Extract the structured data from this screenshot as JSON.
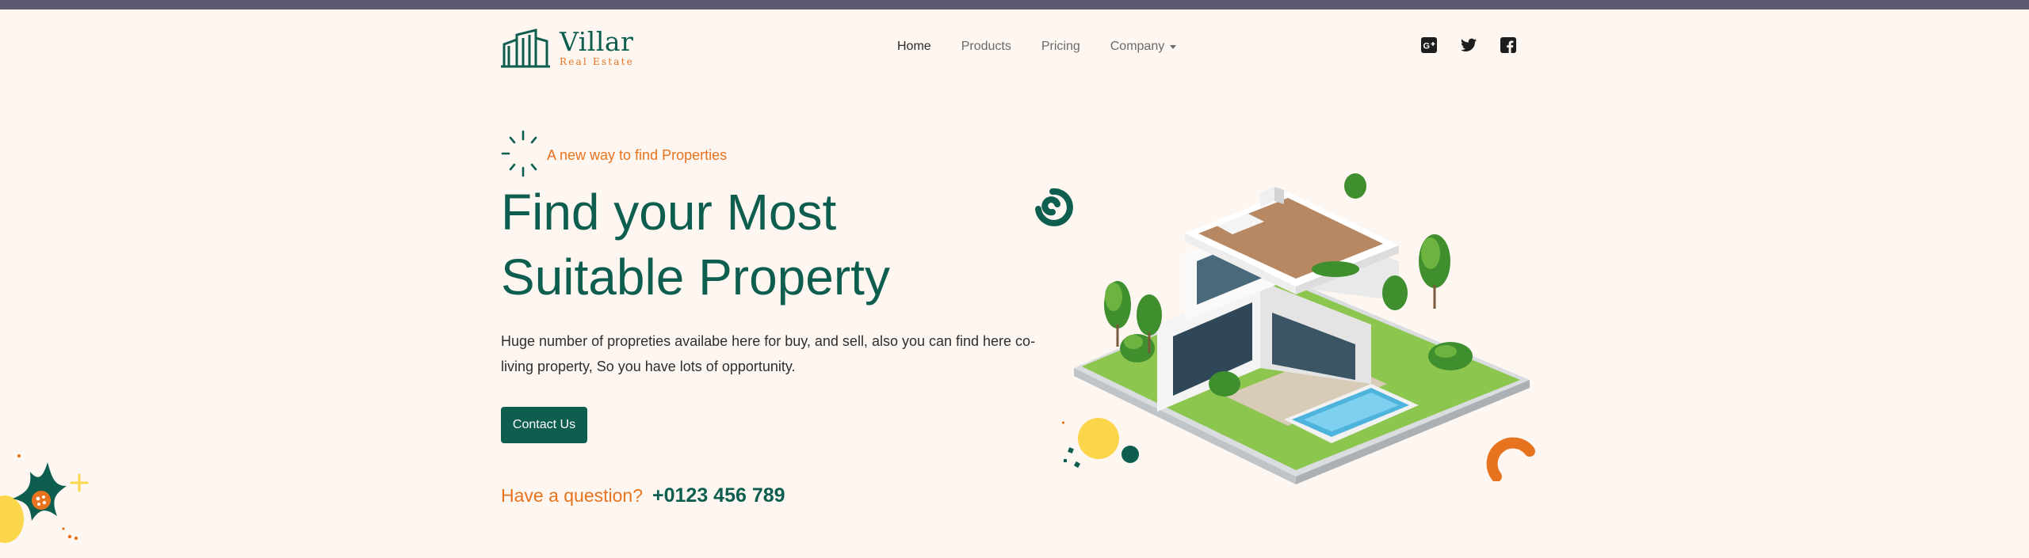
{
  "brand": {
    "name": "Villar",
    "subtitle": "Real Estate"
  },
  "nav": {
    "items": [
      {
        "label": "Home",
        "active": true
      },
      {
        "label": "Products"
      },
      {
        "label": "Pricing"
      },
      {
        "label": "Company",
        "has_dropdown": true
      }
    ],
    "social_icons": [
      "google-plus-icon",
      "twitter-icon",
      "facebook-icon"
    ]
  },
  "hero": {
    "tagline": "A new way to find Properties",
    "headline": "Find your Most Suitable Property",
    "description": "Huge number of propreties availabe here for buy, and sell, also you can find here co-living property, So you have lots of opportunity.",
    "cta_label": "Contact Us",
    "question_label": "Have a question?",
    "phone": "+0123 456 789"
  },
  "colors": {
    "primary": "#0e5e4f",
    "accent": "#e8731e",
    "background": "#fdf6f1",
    "yellow": "#fbd64a"
  }
}
